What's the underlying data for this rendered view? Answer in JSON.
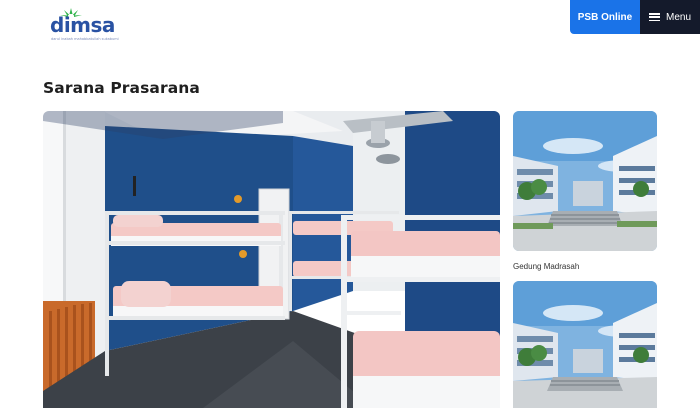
{
  "header": {
    "logo_text": "dimsa",
    "logo_tagline": "darul inabah mahabbatullah sukabumi",
    "psb_label": "PSB Online",
    "menu_label": "Menu"
  },
  "section": {
    "title": "Sarana Prasarana"
  },
  "gallery": {
    "main_alt": "Kamar asrama dengan ranjang susun",
    "thumbs": [
      {
        "caption": "Gedung Madrasah"
      },
      {
        "caption": ""
      }
    ]
  },
  "colors": {
    "accent": "#1a73e8",
    "menu_bg": "#141a2b",
    "logo_blue": "#2952a3",
    "logo_green": "#2fb34a"
  }
}
